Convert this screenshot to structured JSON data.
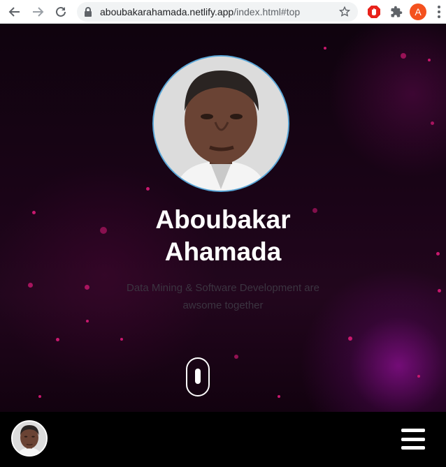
{
  "browser": {
    "url_host": "aboubakarahamada.netlify.app",
    "url_path": "/index.html#top",
    "profile_initial": "A",
    "icons": [
      "back-arrow-icon",
      "forward-arrow-icon",
      "reload-icon",
      "lock-icon",
      "star-icon",
      "shield-extension-icon",
      "puzzle-extension-icon",
      "kebab-menu-icon"
    ]
  },
  "hero": {
    "name_line1": "Aboubakar",
    "name_line2": "Ahamada",
    "tagline": "Data Mining & Software Development are awsome together",
    "colors": {
      "avatar_border": "#5aa7d8",
      "particle": "#c8186e",
      "glow": "#be14c8"
    }
  },
  "bottom_bar": {
    "menu_icon": "hamburger-menu-icon"
  }
}
